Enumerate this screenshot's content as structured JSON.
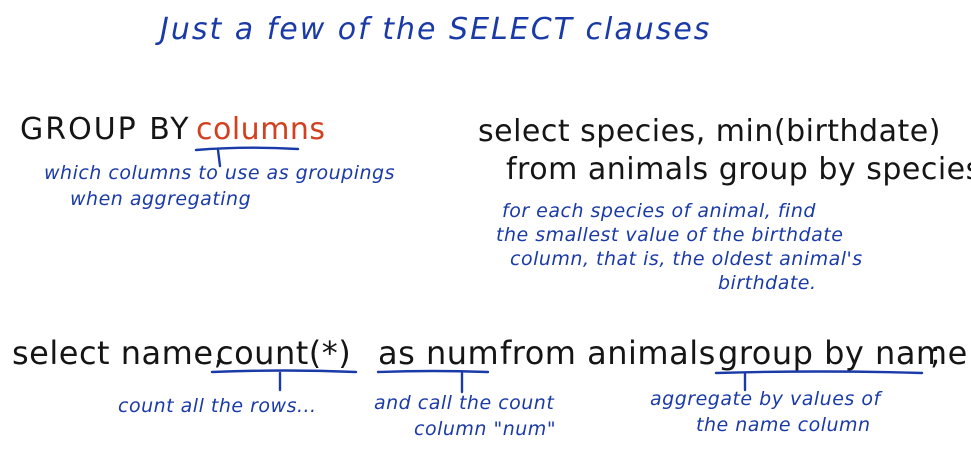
{
  "title": "Just a few of the SELECT clauses",
  "group_by": {
    "keyword": "GROUP BY",
    "arg": "columns",
    "note_line1": "which columns to use as groupings",
    "note_line2": "when aggregating"
  },
  "example1": {
    "line1": "select species, min(birthdate)",
    "line2": "from animals group by species;",
    "note_line1": "for each species of animal, find",
    "note_line2": "the smallest value of the birthdate",
    "note_line3": "column, that is, the oldest animal's",
    "note_line4": "birthdate."
  },
  "example2": {
    "part1": "select name,",
    "part2": "count(*)",
    "part3": "as num",
    "part4": "from animals",
    "part5": "group by name",
    "part6": ";",
    "note_count": "count all the rows...",
    "note_as_line1": "and call the count",
    "note_as_line2": "column \"num\"",
    "note_group_line1": "aggregate by values of",
    "note_group_line2": "the name column"
  },
  "colors": {
    "ink_blue": "#1a3aa8",
    "ink_black": "#151515",
    "ink_red": "#d2401f"
  }
}
